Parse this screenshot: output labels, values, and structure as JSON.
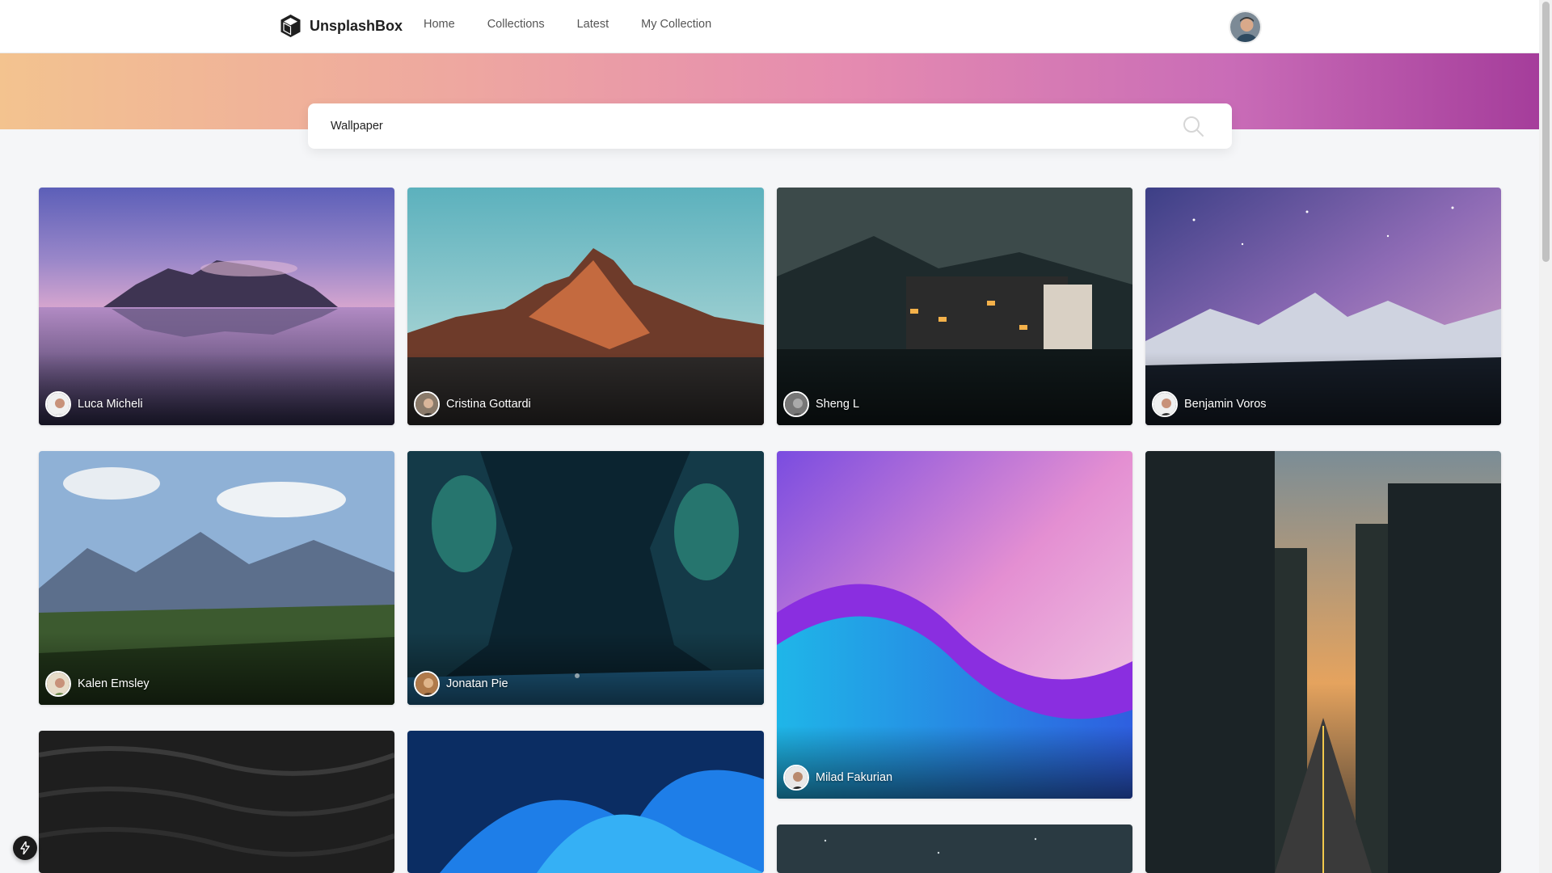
{
  "header": {
    "brand": "UnsplashBox",
    "nav": [
      "Home",
      "Collections",
      "Latest",
      "My Collection"
    ]
  },
  "search": {
    "value": "Wallpaper"
  },
  "photos": [
    {
      "author": "Luca Micheli"
    },
    {
      "author": "Cristina Gottardi"
    },
    {
      "author": "Sheng L"
    },
    {
      "author": "Benjamin Voros"
    },
    {
      "author": "Kalen Emsley"
    },
    {
      "author": "Jonatan Pie"
    },
    {
      "author": "Milad Fakurian"
    }
  ],
  "colors": {
    "hero_gradient": [
      "#f3c38f",
      "#eea7a0",
      "#e58bb0",
      "#c96cb7",
      "#a53d9b"
    ],
    "navbar_bg": "#ffffff",
    "page_bg": "#f5f6f8"
  }
}
